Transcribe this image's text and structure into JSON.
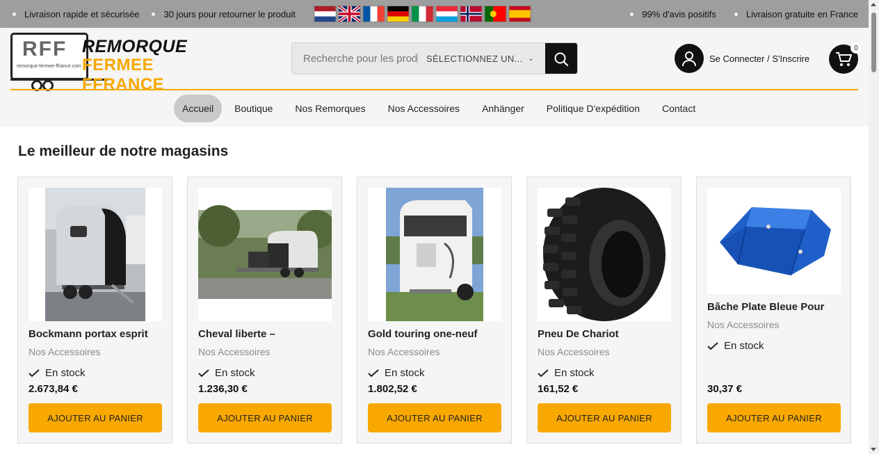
{
  "topbar": {
    "left_items": [
      "Livraison rapide et sécurisée",
      "30 jours pour retourner le produit"
    ],
    "right_items": [
      "99% d'avis positifs",
      "Livraison gratuite en France"
    ],
    "flags": [
      "Netherlands",
      "United Kingdom",
      "France",
      "Germany",
      "Italy",
      "Luxembourg",
      "Norway",
      "Portugal",
      "Spain"
    ]
  },
  "logo": {
    "initials": "RFF",
    "url_text": "remorque-fermee-ffrance.com",
    "line1": "REMORQUE",
    "line2": "FERMEE FFRANCE",
    "accent_color": "#f6a800"
  },
  "search": {
    "placeholder": "Recherche pour les produits",
    "category_label": "SÉLECTIONNEZ UN...",
    "button_icon": "search-icon"
  },
  "account": {
    "label": "Se Connecter / S'Inscrire",
    "icon": "user-icon"
  },
  "cart": {
    "count": "0",
    "icon": "cart-icon"
  },
  "nav": {
    "items": [
      "Accueil",
      "Boutique",
      "Nos Remorques",
      "Nos Accessoires",
      "Anhänger",
      "Politique D'expédition",
      "Contact"
    ],
    "active": "Accueil"
  },
  "main": {
    "section_title": "Le meilleur de notre magasins",
    "products": [
      {
        "title": "Bockmann portax esprit",
        "category": "Nos Accessoires",
        "stock": "En stock",
        "price": "2.673,84 €",
        "button": "AJOUTER AU PANIER"
      },
      {
        "title": "Cheval liberte –",
        "category": "Nos Accessoires",
        "stock": "En stock",
        "price": "1.236,30 €",
        "button": "AJOUTER AU PANIER"
      },
      {
        "title": "Gold touring one-neuf",
        "category": "Nos Accessoires",
        "stock": "En stock",
        "price": "1.802,52 €",
        "button": "AJOUTER AU PANIER"
      },
      {
        "title": "Pneu De Chariot",
        "category": "Nos Accessoires",
        "stock": "En stock",
        "price": "161,52 €",
        "button": "AJOUTER AU PANIER"
      },
      {
        "title": "Bâche Plate Bleue Pour",
        "category": "Nos Accessoires",
        "stock": "En stock",
        "price": "30,37 €",
        "button": "AJOUTER AU PANIER"
      }
    ]
  },
  "colors": {
    "topbar_bg": "#9e9e9e",
    "header_bg": "#f5f5f5",
    "accent": "#f9a800",
    "dark": "#111111"
  }
}
